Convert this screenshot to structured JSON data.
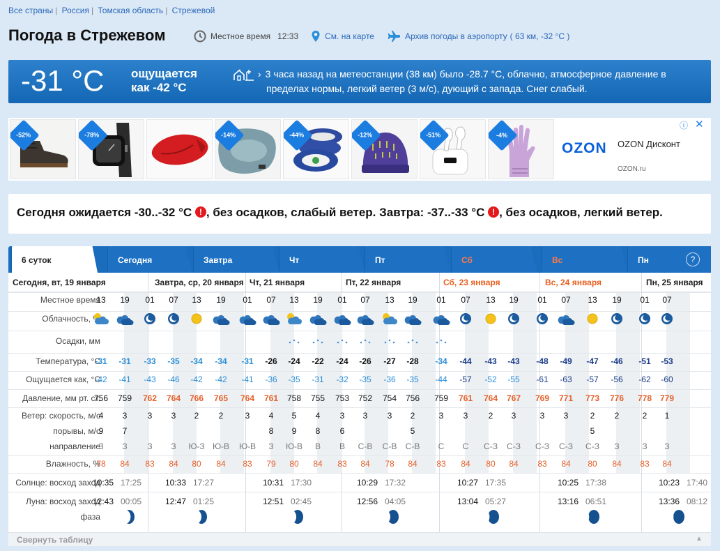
{
  "breadcrumbs": [
    "Все страны",
    "Россия",
    "Томская область",
    "Стрежевой"
  ],
  "title": "Погода в Стрежевом",
  "header_links": {
    "local_time_label": "Местное время",
    "local_time": "12:33",
    "map_link": "См. на карте",
    "archive_link": "Архив погоды в аэропорту",
    "archive_meta": "( 63 км, -32 °С )"
  },
  "current": {
    "temp": "-31 °C",
    "feels_line1": "ощущается",
    "feels_line2": "как -42 °C",
    "observation": "3 часа назад на метеостанции (38 км) было -28.7 °C, облачно, атмосферное давление в пределах нормы, легкий ветер (3 м/с), дующий с запада. Снег слабый."
  },
  "ad": {
    "items": [
      {
        "discount": "-52%",
        "icon": "boots-icon"
      },
      {
        "discount": "-78%",
        "icon": "smartwatch-icon"
      },
      {
        "discount": "",
        "icon": "sleeping-bag-icon"
      },
      {
        "discount": "-14%",
        "icon": "pet-bed-icon"
      },
      {
        "discount": "-44%",
        "icon": "bowls-icon"
      },
      {
        "discount": "-12%",
        "icon": "hat-icon"
      },
      {
        "discount": "-51%",
        "icon": "earbuds-icon"
      },
      {
        "discount": "-4%",
        "icon": "gloves-icon"
      }
    ],
    "logo": "OZON",
    "brand_title": "OZON Дисконт",
    "url": "OZON.ru",
    "info": "ⓘ",
    "close": "✕"
  },
  "summary": {
    "part1": "Сегодня ожидается -30..-32 °C",
    "part2": ", без осадков, слабый ветер. Завтра: -37..-33 °C",
    "part3": ", без осадков, легкий ветер.",
    "warn": "!"
  },
  "tabs": [
    "6 суток",
    "Сегодня",
    "Завтра",
    "Чт",
    "Пт",
    "Сб",
    "Вс",
    "Пн"
  ],
  "help": "?",
  "days": [
    "Сегодня, вт, 19 января",
    "Завтра, ср, 20 января",
    "Чт, 21 января",
    "Пт, 22 января",
    "Сб, 23 января",
    "Вс, 24 января",
    "Пн, 25 января"
  ],
  "row_labels": {
    "time": "Местное время",
    "cloud": "Облачность, %",
    "precip": "Осадки, мм",
    "temp": "Температура, °С",
    "feels": "Ощущается как, °С",
    "pressure": "Давление, мм рт. ст.",
    "wind_speed": "Ветер: скорость, м/с",
    "gusts": "порывы, м/с",
    "direction": "направление",
    "humidity": "Влажность, %",
    "sun": "Солнце: восход заход",
    "moon": "Луна: восход заход",
    "phase": "фаза"
  },
  "hours": [
    "13",
    "19",
    "01",
    "07",
    "13",
    "19",
    "01",
    "07",
    "13",
    "19",
    "01",
    "07",
    "13",
    "19",
    "01",
    "07",
    "13",
    "19",
    "01",
    "07",
    "13",
    "19",
    "01",
    "07"
  ],
  "clouds": [
    "sun-cloud-icon",
    "cloud-icon",
    "moon-icon",
    "moon-icon",
    "sun-icon",
    "cloud-icon",
    "cloud-icon",
    "cloud-icon",
    "sun-cloud-icon",
    "cloud-icon",
    "cloud-icon",
    "cloud-icon",
    "sun-cloud-icon",
    "cloud-icon",
    "cloud-icon",
    "moon-icon",
    "sun-icon",
    "moon-icon",
    "moon-icon",
    "cloud-icon",
    "sun-icon",
    "moon-icon",
    "moon-icon",
    "moon-icon"
  ],
  "snow": [
    "",
    "",
    "",
    "",
    "",
    "",
    "",
    "",
    "",
    "",
    "",
    "",
    "",
    "",
    "",
    "",
    "",
    "",
    "",
    "",
    "",
    "",
    "",
    ""
  ],
  "temp": [
    "-31",
    "-31",
    "-33",
    "-35",
    "-34",
    "-34",
    "-31",
    "-26",
    "-24",
    "-22",
    "-24",
    "-26",
    "-27",
    "-28",
    "-34",
    "-44",
    "-43",
    "-43",
    "-48",
    "-49",
    "-47",
    "-46",
    "-51",
    "-53"
  ],
  "feels": [
    "-42",
    "-41",
    "-43",
    "-46",
    "-42",
    "-42",
    "-41",
    "-36",
    "-35",
    "-31",
    "-32",
    "-35",
    "-36",
    "-35",
    "-44",
    "-57",
    "-52",
    "-55",
    "-61",
    "-63",
    "-57",
    "-56",
    "-62",
    "-60"
  ],
  "pressure": [
    "756",
    "759",
    "762",
    "764",
    "766",
    "765",
    "764",
    "761",
    "758",
    "755",
    "753",
    "752",
    "754",
    "756",
    "759",
    "761",
    "764",
    "767",
    "769",
    "771",
    "773",
    "776",
    "778",
    "779"
  ],
  "wind": [
    "4",
    "3",
    "3",
    "3",
    "2",
    "2",
    "3",
    "4",
    "5",
    "4",
    "3",
    "3",
    "3",
    "2",
    "3",
    "3",
    "2",
    "3",
    "3",
    "3",
    "2",
    "2",
    "2",
    "1"
  ],
  "gusts": [
    "9",
    "7",
    "",
    "",
    "",
    "",
    "",
    "8",
    "9",
    "8",
    "6",
    "",
    "",
    "5",
    "",
    "",
    "",
    "",
    "",
    "",
    "5",
    "",
    "",
    ""
  ],
  "direction": [
    "З",
    "З",
    "З",
    "З",
    "Ю-З",
    "Ю-В",
    "Ю-В",
    "З",
    "Ю-В",
    "В",
    "В",
    "С-В",
    "С-В",
    "С-В",
    "С",
    "С",
    "С-З",
    "С-З",
    "С-З",
    "С-З",
    "С-З",
    "З",
    "З",
    "З"
  ],
  "humidity": [
    "78",
    "84",
    "83",
    "84",
    "80",
    "84",
    "83",
    "79",
    "80",
    "84",
    "83",
    "84",
    "78",
    "84",
    "83",
    "84",
    "80",
    "84",
    "83",
    "84",
    "80",
    "84",
    "83",
    "84"
  ],
  "sun": [
    [
      "10:35",
      "17:25"
    ],
    [
      "10:33",
      "17:27"
    ],
    [
      "10:31",
      "17:30"
    ],
    [
      "10:29",
      "17:32"
    ],
    [
      "10:27",
      "17:35"
    ],
    [
      "10:25",
      "17:38"
    ],
    [
      "10:23",
      "17:40"
    ]
  ],
  "moon": [
    [
      "12:43",
      "00:05"
    ],
    [
      "12:47",
      "01:25"
    ],
    [
      "12:51",
      "02:45"
    ],
    [
      "12:56",
      "04:05"
    ],
    [
      "13:04",
      "05:27"
    ],
    [
      "13:16",
      "06:51"
    ],
    [
      "13:36",
      "08:12"
    ]
  ],
  "collapse": "Свернуть таблицу",
  "colors": {
    "accent": "#1a6cbd",
    "temp_blue": "#2b8ed8",
    "temp_dark": "#1c3d8a",
    "orange": "#e5602a"
  }
}
